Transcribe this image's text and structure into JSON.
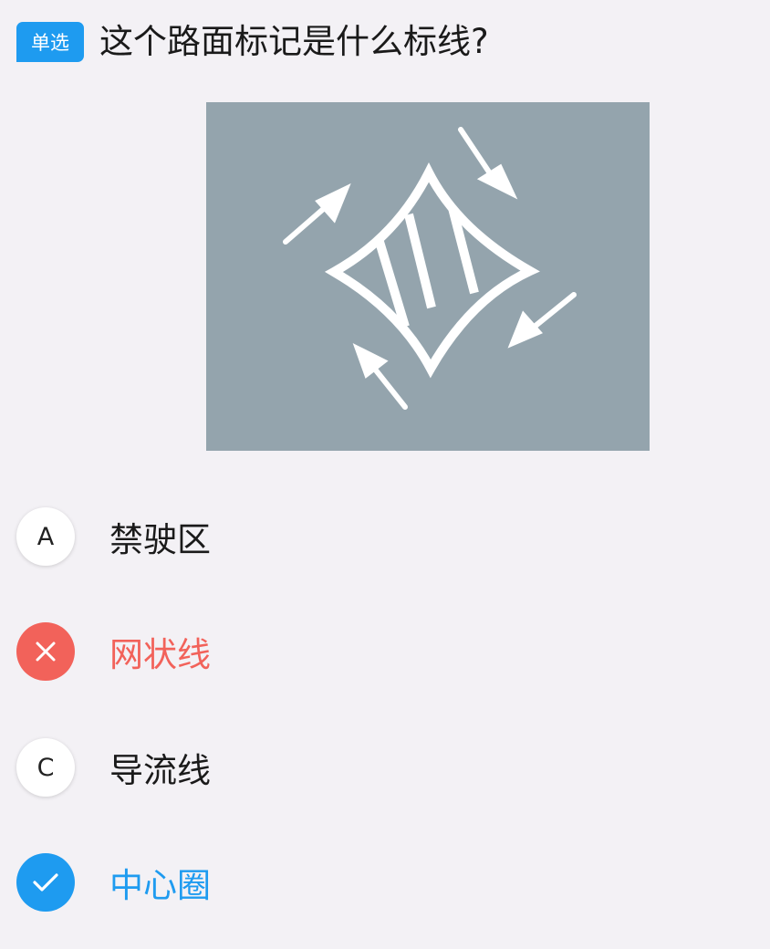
{
  "question": {
    "type_badge": "单选",
    "text": "这个路面标记是什么标线?"
  },
  "figure": {
    "subject": "diamond-road-marking-with-four-arrows",
    "background_color": "#94a4ad",
    "marking_color": "#ffffff"
  },
  "options": [
    {
      "letter": "A",
      "label": "禁驶区",
      "state": "unselected"
    },
    {
      "letter": "B",
      "label": "网状线",
      "state": "wrong",
      "icon": "close-icon"
    },
    {
      "letter": "C",
      "label": "导流线",
      "state": "unselected"
    },
    {
      "letter": "D",
      "label": "中心圈",
      "state": "correct",
      "icon": "check-icon"
    }
  ],
  "colors": {
    "accent": "#1e9bf0",
    "wrong": "#f2625a",
    "background": "#f3f1f5",
    "text": "#1a1a1a"
  }
}
